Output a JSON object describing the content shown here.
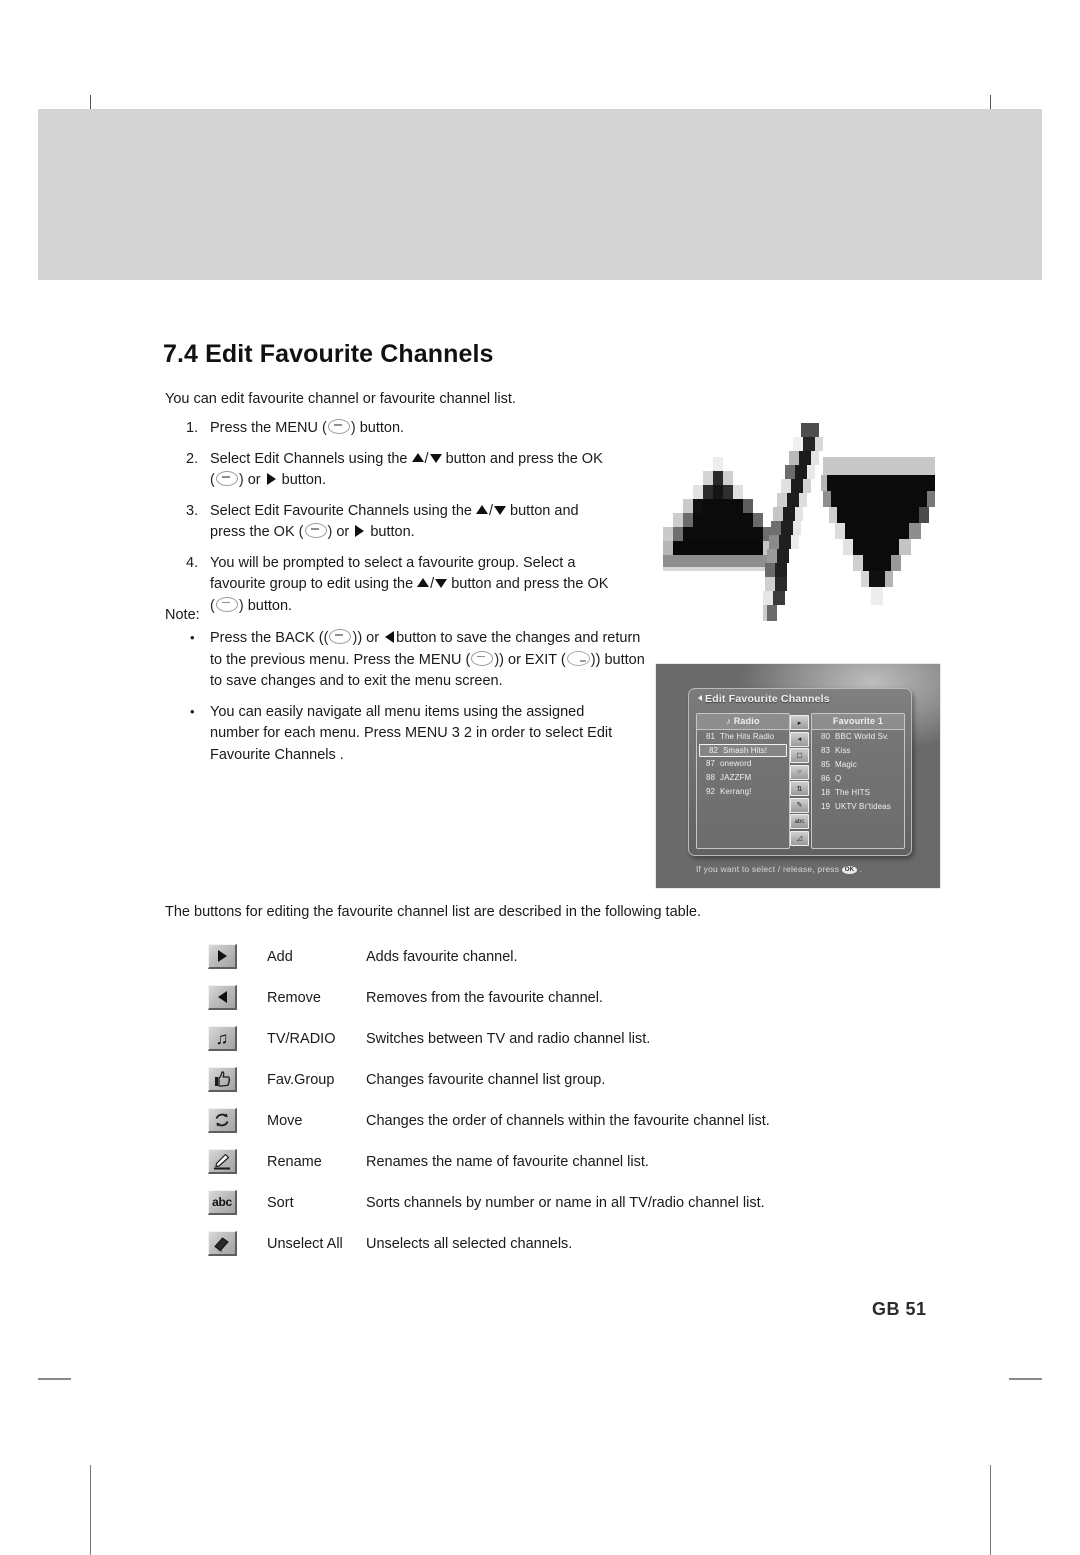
{
  "page": {
    "section_number": "7.4",
    "section_title": "7.4 Edit Favourite Channels",
    "intro": "You can edit favourite channel or favourite channel list.",
    "footer": "GB 51"
  },
  "steps": [
    {
      "num": "1.",
      "parts": [
        "Press the MENU (",
        "MENU-BTN",
        ") button."
      ],
      "text_plain": "Press the MENU ( ) button."
    },
    {
      "num": "2.",
      "text_plain": "Select Edit Channels  using the  /  button and press the OK ( ) or  button.",
      "seg_a": "Select Edit Channels  using the ",
      "seg_b": " button and press the OK",
      "seg_c": " or ",
      "seg_d": " button."
    },
    {
      "num": "3.",
      "text_plain": "Select Edit Favourite Channels  using the  /  button and press the OK ( ) or  button.",
      "seg_a": "Select Edit Favourite Channels  using the ",
      "seg_b": " button and",
      "seg_c": "press the OK",
      "seg_d": " or ",
      "seg_e": " button."
    },
    {
      "num": "4.",
      "text_plain": "You will be prompted to select a favourite group. Select a favourite group to edit using the  /  button and press the OK ( ) button.",
      "seg_a": "You will be prompted to select a favourite group. Select a",
      "seg_b": "favourite group to edit using the ",
      "seg_c": " button and press the OK",
      "seg_d": " button."
    }
  ],
  "note": {
    "label": "Note:",
    "items": [
      {
        "seg_a": "Press the BACK (",
        "seg_b": ") or ",
        "seg_c": "button to save the changes and return",
        "seg_d": "to the previous menu. Press the MENU (",
        "seg_e": ") or EXIT (",
        "seg_f": ") button",
        "seg_g": "to save changes and to exit the menu screen.",
        "text_plain": "Press the BACK ( ) or  button to save the changes and return to the previous menu. Press the MENU ( ) or EXIT ( ) button to save changes and to exit the menu screen."
      },
      {
        "line1": "You can easily navigate all menu items using the assigned",
        "line2": "number for each menu. Press MENU 3 2  in order to select Edit",
        "line3": "Favourite Channels  .",
        "text_plain": "You can easily navigate all menu items using the assigned number for each menu. Press MENU 3 2 in order to select Edit Favourite Channels ."
      }
    ]
  },
  "tv_screenshot": {
    "title": "Edit Favourite Channels",
    "left_panel": {
      "header": "Radio",
      "header_icon": "music-note-icon",
      "rows": [
        {
          "num": "81",
          "name": "The Hits Radio",
          "selected": false
        },
        {
          "num": "82",
          "name": "Smash Hits!",
          "selected": true
        },
        {
          "num": "87",
          "name": "oneword",
          "selected": false
        },
        {
          "num": "88",
          "name": "JAZZFM",
          "selected": false
        },
        {
          "num": "92",
          "name": "Kerrang!",
          "selected": false
        }
      ]
    },
    "right_panel": {
      "header": "Favourite 1",
      "rows": [
        {
          "num": "80",
          "name": "BBC World Sv."
        },
        {
          "num": "83",
          "name": "Kiss"
        },
        {
          "num": "85",
          "name": "Magic"
        },
        {
          "num": "86",
          "name": "Q"
        },
        {
          "num": "18",
          "name": "The HITS"
        },
        {
          "num": "19",
          "name": "UKTV Br'tideas"
        }
      ]
    },
    "icon_column": [
      "add-icon",
      "remove-icon",
      "tv-radio-icon",
      "fav-group-icon",
      "move-icon",
      "rename-icon",
      "sort-icon",
      "unselect-all-icon"
    ],
    "status_text": "If you want to select / release, press",
    "status_key": "OK"
  },
  "table": {
    "intro": "The buttons for editing the favourite channel list are described in the following table.",
    "rows": [
      {
        "icon": "arrow-right-icon",
        "label": "Add",
        "desc": "Adds favourite channel."
      },
      {
        "icon": "arrow-left-icon",
        "label": "Remove",
        "desc": "Removes from the favourite channel."
      },
      {
        "icon": "music-note-icon",
        "label": "TV/RADIO",
        "desc": "Switches between TV and radio channel list."
      },
      {
        "icon": "thumbs-up-icon",
        "label": "Fav.Group",
        "desc": "Changes favourite channel list group."
      },
      {
        "icon": "refresh-icon",
        "label": "Move",
        "desc": "Changes the order of channels within the favourite channel list."
      },
      {
        "icon": "pencil-icon",
        "label": "Rename",
        "desc": "Renames the name of favourite channel list."
      },
      {
        "icon": "abc-icon",
        "label": "Sort",
        "desc": "Sorts channels by number or name in all TV/radio channel list."
      },
      {
        "icon": "eraser-icon",
        "label": "Unselect All",
        "desc": "Unselects all selected channels."
      }
    ]
  },
  "colors": {
    "header_band": "#d4d4d4",
    "text": "#1a1a1a",
    "button_face": "#bdbdbd"
  }
}
